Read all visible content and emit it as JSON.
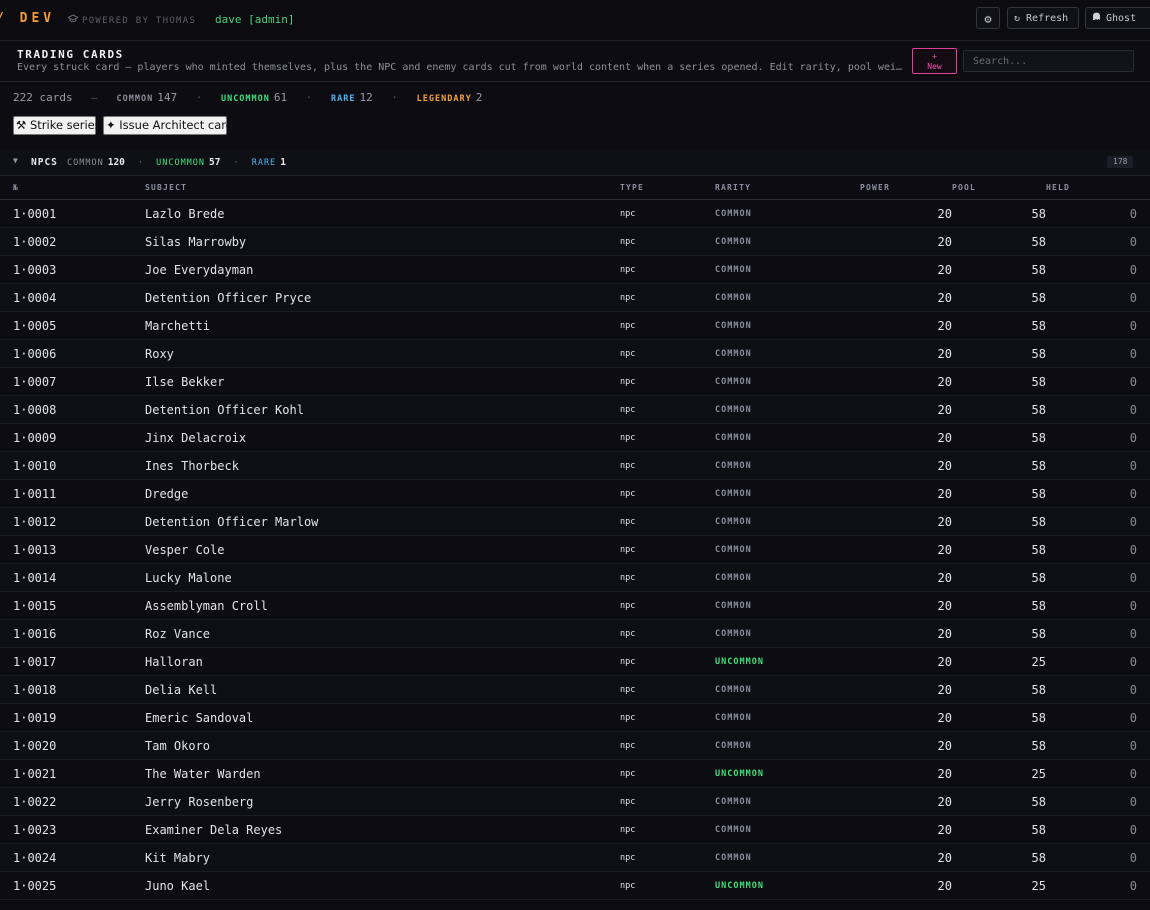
{
  "topbar": {
    "brand": "/ DEV",
    "powered_by": "POWERED BY THOMAS",
    "powered_icon": "graduation-cap-icon",
    "user": "dave [admin]",
    "settings_icon": "⚙",
    "refresh_label": "↻ Refresh",
    "ghost_label": "Ghost"
  },
  "page": {
    "title": "TRADING CARDS",
    "description": "Every struck card — players who minted themselves, plus the NPC and enemy cards cut from world content when a series opened. Edit rarity, pool wei…",
    "new_button": "+ New",
    "search_placeholder": "Search..."
  },
  "stats": {
    "total": "222 cards",
    "dash": "—",
    "common_label": "COMMON",
    "common_count": "147",
    "uncommon_label": "UNCOMMON",
    "uncommon_count": "61",
    "rare_label": "RARE",
    "rare_count": "12",
    "legendary_label": "LEGENDARY",
    "legendary_count": "2",
    "sep": "·"
  },
  "actions": {
    "strike": "⚒ Strike series",
    "architect": "✦ Issue Architect card"
  },
  "group": {
    "toggle": "▼",
    "name": "NPCS",
    "common_label": "COMMON",
    "common_count": "120",
    "uncommon_label": "UNCOMMON",
    "uncommon_count": "57",
    "rare_label": "RARE",
    "rare_count": "1",
    "sep": "·",
    "total": "178"
  },
  "columns": {
    "id": "№",
    "subject": "SUBJECT",
    "type": "TYPE",
    "rarity": "RARITY",
    "power": "POWER",
    "pool": "POOL",
    "held": "HELD"
  },
  "colors": {
    "common": "#8f8f9c",
    "uncommon": "#3ee07b",
    "rare": "#4fb5f0",
    "legendary": "#f2a13c",
    "accent": "#f056ad"
  },
  "rows": [
    {
      "id": "1·0001",
      "subject": "Lazlo Brede",
      "type": "npc",
      "rarity": "COMMON",
      "power": "20",
      "pool": "58",
      "held": "0"
    },
    {
      "id": "1·0002",
      "subject": "Silas Marrowby",
      "type": "npc",
      "rarity": "COMMON",
      "power": "20",
      "pool": "58",
      "held": "0"
    },
    {
      "id": "1·0003",
      "subject": "Joe Everydayman",
      "type": "npc",
      "rarity": "COMMON",
      "power": "20",
      "pool": "58",
      "held": "0"
    },
    {
      "id": "1·0004",
      "subject": "Detention Officer Pryce",
      "type": "npc",
      "rarity": "COMMON",
      "power": "20",
      "pool": "58",
      "held": "0"
    },
    {
      "id": "1·0005",
      "subject": "Marchetti",
      "type": "npc",
      "rarity": "COMMON",
      "power": "20",
      "pool": "58",
      "held": "0"
    },
    {
      "id": "1·0006",
      "subject": "Roxy",
      "type": "npc",
      "rarity": "COMMON",
      "power": "20",
      "pool": "58",
      "held": "0"
    },
    {
      "id": "1·0007",
      "subject": "Ilse Bekker",
      "type": "npc",
      "rarity": "COMMON",
      "power": "20",
      "pool": "58",
      "held": "0"
    },
    {
      "id": "1·0008",
      "subject": "Detention Officer Kohl",
      "type": "npc",
      "rarity": "COMMON",
      "power": "20",
      "pool": "58",
      "held": "0"
    },
    {
      "id": "1·0009",
      "subject": "Jinx Delacroix",
      "type": "npc",
      "rarity": "COMMON",
      "power": "20",
      "pool": "58",
      "held": "0"
    },
    {
      "id": "1·0010",
      "subject": "Ines Thorbeck",
      "type": "npc",
      "rarity": "COMMON",
      "power": "20",
      "pool": "58",
      "held": "0"
    },
    {
      "id": "1·0011",
      "subject": "Dredge",
      "type": "npc",
      "rarity": "COMMON",
      "power": "20",
      "pool": "58",
      "held": "0"
    },
    {
      "id": "1·0012",
      "subject": "Detention Officer Marlow",
      "type": "npc",
      "rarity": "COMMON",
      "power": "20",
      "pool": "58",
      "held": "0"
    },
    {
      "id": "1·0013",
      "subject": "Vesper Cole",
      "type": "npc",
      "rarity": "COMMON",
      "power": "20",
      "pool": "58",
      "held": "0"
    },
    {
      "id": "1·0014",
      "subject": "Lucky Malone",
      "type": "npc",
      "rarity": "COMMON",
      "power": "20",
      "pool": "58",
      "held": "0"
    },
    {
      "id": "1·0015",
      "subject": "Assemblyman Croll",
      "type": "npc",
      "rarity": "COMMON",
      "power": "20",
      "pool": "58",
      "held": "0"
    },
    {
      "id": "1·0016",
      "subject": "Roz Vance",
      "type": "npc",
      "rarity": "COMMON",
      "power": "20",
      "pool": "58",
      "held": "0"
    },
    {
      "id": "1·0017",
      "subject": "Halloran",
      "type": "npc",
      "rarity": "UNCOMMON",
      "power": "20",
      "pool": "25",
      "held": "0"
    },
    {
      "id": "1·0018",
      "subject": "Delia Kell",
      "type": "npc",
      "rarity": "COMMON",
      "power": "20",
      "pool": "58",
      "held": "0"
    },
    {
      "id": "1·0019",
      "subject": "Emeric Sandoval",
      "type": "npc",
      "rarity": "COMMON",
      "power": "20",
      "pool": "58",
      "held": "0"
    },
    {
      "id": "1·0020",
      "subject": "Tam Okoro",
      "type": "npc",
      "rarity": "COMMON",
      "power": "20",
      "pool": "58",
      "held": "0"
    },
    {
      "id": "1·0021",
      "subject": "The Water Warden",
      "type": "npc",
      "rarity": "UNCOMMON",
      "power": "20",
      "pool": "25",
      "held": "0"
    },
    {
      "id": "1·0022",
      "subject": "Jerry Rosenberg",
      "type": "npc",
      "rarity": "COMMON",
      "power": "20",
      "pool": "58",
      "held": "0"
    },
    {
      "id": "1·0023",
      "subject": "Examiner Dela Reyes",
      "type": "npc",
      "rarity": "COMMON",
      "power": "20",
      "pool": "58",
      "held": "0"
    },
    {
      "id": "1·0024",
      "subject": "Kit Mabry",
      "type": "npc",
      "rarity": "COMMON",
      "power": "20",
      "pool": "58",
      "held": "0"
    },
    {
      "id": "1·0025",
      "subject": "Juno Kael",
      "type": "npc",
      "rarity": "UNCOMMON",
      "power": "20",
      "pool": "25",
      "held": "0"
    }
  ]
}
